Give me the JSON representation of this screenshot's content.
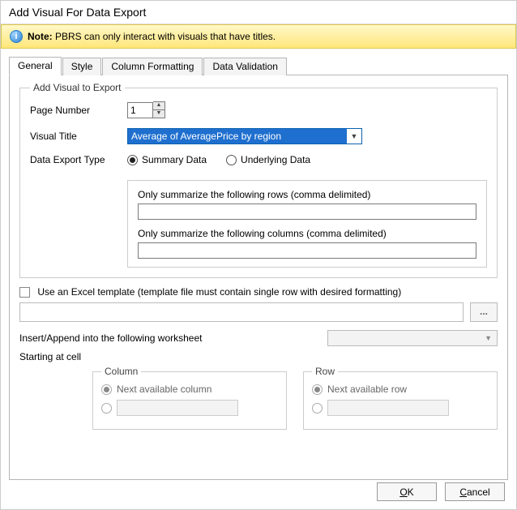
{
  "title": "Add Visual For Data Export",
  "note": {
    "prefix": "Note:",
    "text": " PBRS can only interact with visuals that have titles."
  },
  "tabs": [
    "General",
    "Style",
    "Column Formatting",
    "Data Validation"
  ],
  "activeTab": 0,
  "group": {
    "legend": "Add Visual to Export",
    "pageNumberLabel": "Page Number",
    "pageNumberValue": "1",
    "visualTitleLabel": "Visual Title",
    "visualTitleValue": "Average of AveragePrice by region",
    "exportTypeLabel": "Data Export Type",
    "radios": {
      "summary": "Summary Data",
      "underlying": "Underlying Data"
    },
    "exportTypeSelected": "summary",
    "rowsLabel": "Only summarize the following rows (comma delimited)",
    "rowsValue": "",
    "colsLabel": "Only summarize the following columns (comma delimited)",
    "colsValue": ""
  },
  "excel": {
    "checkboxLabel": "Use an Excel template (template file must contain single row with desired formatting)",
    "checked": false,
    "path": "",
    "browseLabel": "...",
    "worksheetLabel": "Insert/Append into the following worksheet",
    "worksheetValue": "",
    "startLabel": "Starting at cell",
    "column": {
      "legend": "Column",
      "nextLabel": "Next available column",
      "customValue": ""
    },
    "row": {
      "legend": "Row",
      "nextLabel": "Next available row",
      "customValue": ""
    }
  },
  "buttons": {
    "ok": "OK",
    "okUnderline": "O",
    "okRest": "K",
    "cancel": "Cancel",
    "cancelUnderline": "C",
    "cancelRest": "ancel"
  }
}
